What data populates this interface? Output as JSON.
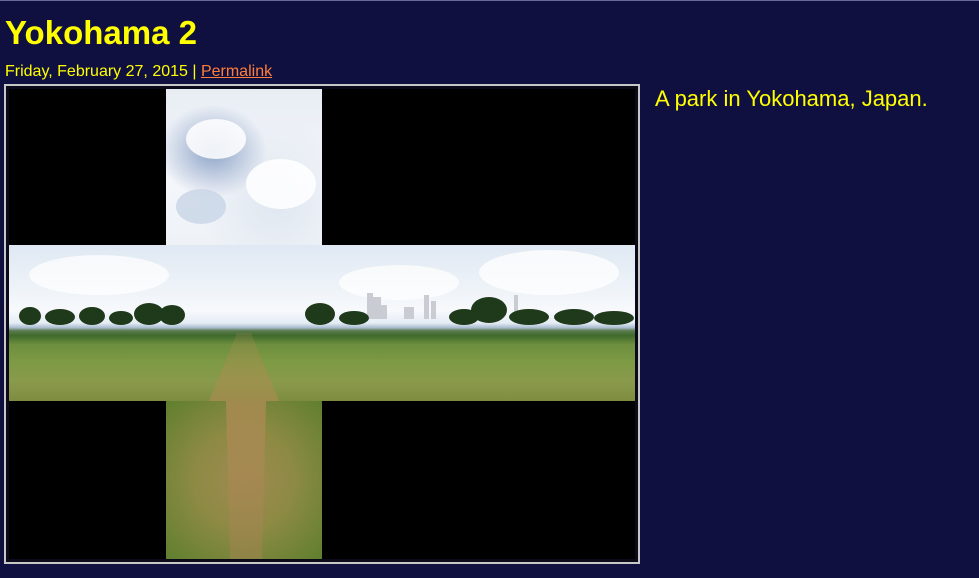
{
  "post": {
    "title": "Yokohama 2",
    "date": "Friday, February 27, 2015",
    "separator": " | ",
    "permalink_label": "Permalink",
    "caption": "A park in Yokohama, Japan."
  },
  "photo": {
    "description_icon": "panorama-cubemap-image",
    "colors": {
      "background": "#101040",
      "title": "#ffff00",
      "link": "#ff7f3a",
      "frame": "#c7c7c7"
    }
  }
}
